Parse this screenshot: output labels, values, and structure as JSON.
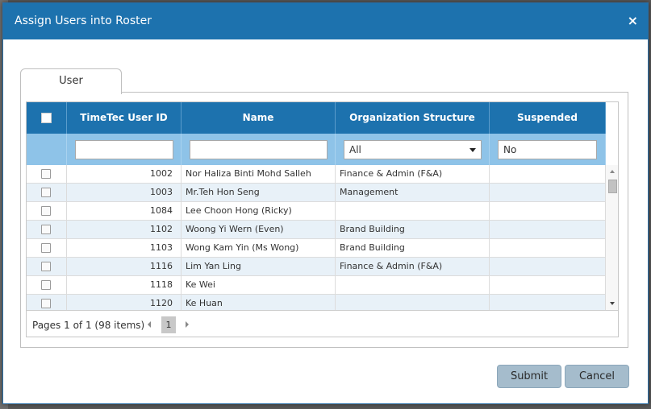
{
  "dialog": {
    "title": "Assign Users into Roster",
    "close_label": "×"
  },
  "tabs": [
    {
      "label": "User",
      "active": true
    }
  ],
  "grid": {
    "columns": [
      "TimeTec User ID",
      "Name",
      "Organization Structure",
      "Suspended"
    ],
    "filters": {
      "user_id": "",
      "name": "",
      "org_structure": "All",
      "suspended": "No"
    },
    "rows": [
      {
        "id": "1002",
        "name": "Nor Haliza Binti Mohd Salleh",
        "org": "Finance & Admin (F&A)",
        "suspended": ""
      },
      {
        "id": "1003",
        "name": "Mr.Teh Hon Seng",
        "org": "Management",
        "suspended": ""
      },
      {
        "id": "1084",
        "name": "Lee Choon Hong (Ricky)",
        "org": "",
        "suspended": ""
      },
      {
        "id": "1102",
        "name": "Woong Yi Wern (Even)",
        "org": "Brand Building",
        "suspended": ""
      },
      {
        "id": "1103",
        "name": "Wong Kam Yin (Ms Wong)",
        "org": "Brand Building",
        "suspended": ""
      },
      {
        "id": "1116",
        "name": "Lim Yan Ling",
        "org": "Finance & Admin (F&A)",
        "suspended": ""
      },
      {
        "id": "1118",
        "name": "Ke Wei",
        "org": "",
        "suspended": ""
      },
      {
        "id": "1120",
        "name": "Ke Huan",
        "org": "",
        "suspended": ""
      }
    ],
    "pager": {
      "info": "Pages 1 of 1 (98 items)",
      "current_page": "1"
    }
  },
  "buttons": {
    "submit": "Submit",
    "cancel": "Cancel"
  },
  "colors": {
    "header_blue": "#1d72ae",
    "filter_blue": "#8ec3e8",
    "button_gray_blue": "#a5bccc"
  }
}
